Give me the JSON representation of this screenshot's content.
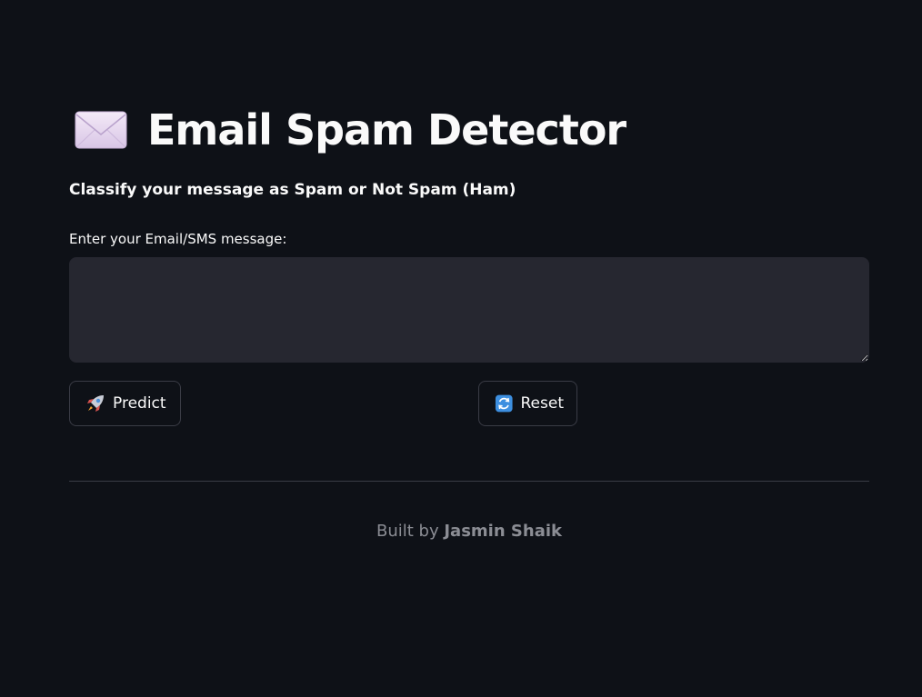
{
  "app": {
    "title": "Email Spam Detector",
    "title_icon": "envelope-icon",
    "subtitle": "Classify your message as Spam or Not Spam (Ham)"
  },
  "form": {
    "message_label": "Enter your Email/SMS message:",
    "message_value": "",
    "message_placeholder": ""
  },
  "actions": {
    "predict_label": "Predict",
    "predict_icon": "rocket-icon",
    "reset_label": "Reset",
    "reset_icon": "refresh-icon"
  },
  "footer": {
    "prefix": "Built by",
    "author": "Jasmin Shaik"
  },
  "colors": {
    "background": "#0e1117",
    "input_background": "#262730",
    "text": "#fafafa",
    "muted_text": "#8b8d94",
    "border": "#3a3c46"
  }
}
